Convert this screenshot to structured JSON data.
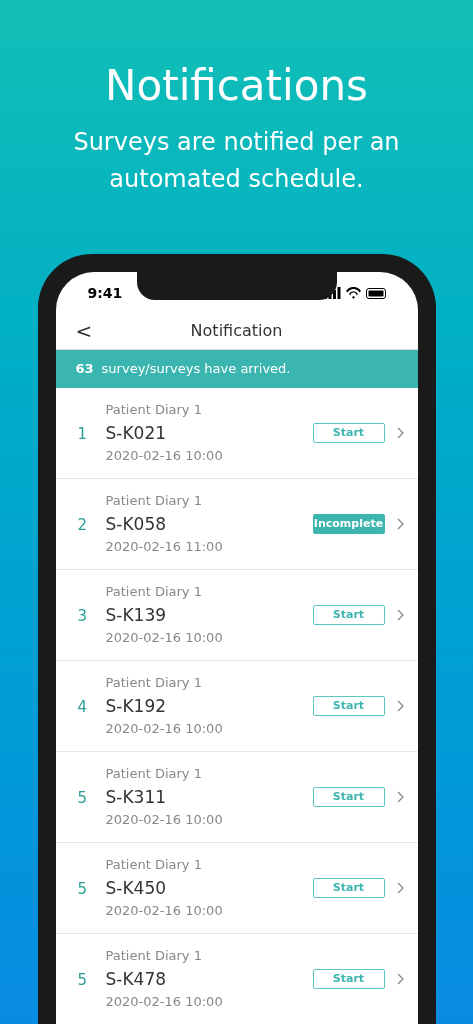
{
  "headline": "Notifications",
  "subtitle": "Surveys are notified per an automated schedule.",
  "status_bar": {
    "time": "9:41"
  },
  "nav": {
    "back": "<",
    "title": "Notification"
  },
  "banner": {
    "count": "63",
    "text": "survey/surveys have arrived."
  },
  "items": [
    {
      "index": "1",
      "survey": "Patient Diary 1",
      "code": "S-K021",
      "date": "2020-02-16 10:00",
      "kind": "start",
      "action": "Start"
    },
    {
      "index": "2",
      "survey": "Patient Diary 1",
      "code": "S-K058",
      "date": "2020-02-16 11:00",
      "kind": "incomplete",
      "action": "Incomplete"
    },
    {
      "index": "3",
      "survey": "Patient Diary 1",
      "code": "S-K139",
      "date": "2020-02-16 10:00",
      "kind": "start",
      "action": "Start"
    },
    {
      "index": "4",
      "survey": "Patient Diary 1",
      "code": "S-K192",
      "date": "2020-02-16 10:00",
      "kind": "start",
      "action": "Start"
    },
    {
      "index": "5",
      "survey": "Patient Diary 1",
      "code": "S-K311",
      "date": "2020-02-16 10:00",
      "kind": "start",
      "action": "Start"
    },
    {
      "index": "5",
      "survey": "Patient Diary 1",
      "code": "S-K450",
      "date": "2020-02-16 10:00",
      "kind": "start",
      "action": "Start"
    },
    {
      "index": "5",
      "survey": "Patient Diary 1",
      "code": "S-K478",
      "date": "2020-02-16 10:00",
      "kind": "start",
      "action": "Start"
    }
  ]
}
